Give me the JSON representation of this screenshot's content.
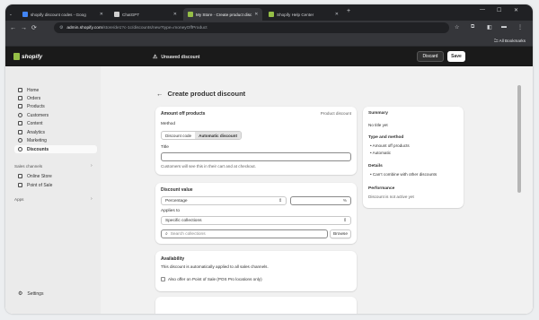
{
  "browser": {
    "tabs": [
      {
        "label": "shopify discount codes - Goog",
        "fav": "#4285f4"
      },
      {
        "label": "ChatGPT",
        "fav": "#cfcfcf"
      },
      {
        "label": "My Store · Create product disc",
        "fav": "#95bf47"
      },
      {
        "label": "Shopify Help Center",
        "fav": "#95bf47"
      }
    ],
    "url_host": "admin.shopify.com",
    "url_path": "/store/de1?c-1c/discounts/new?type=moneyOffProduct",
    "all_bookmarks": "All Bookmarks"
  },
  "topbar": {
    "logo": "shopify",
    "unsaved": "Unsaved discount",
    "discard": "Discard",
    "save": "Save"
  },
  "sidebar": {
    "items": [
      {
        "label": "Home",
        "icon": "home-icon"
      },
      {
        "label": "Orders",
        "icon": "orders-icon"
      },
      {
        "label": "Products",
        "icon": "tag-icon"
      },
      {
        "label": "Customers",
        "icon": "person-icon"
      },
      {
        "label": "Content",
        "icon": "content-icon"
      },
      {
        "label": "Analytics",
        "icon": "chart-icon"
      },
      {
        "label": "Marketing",
        "icon": "target-icon"
      },
      {
        "label": "Discounts",
        "icon": "discount-icon"
      }
    ],
    "sales_channels": "Sales channels",
    "channels": [
      {
        "label": "Online Store"
      },
      {
        "label": "Point of Sale"
      }
    ],
    "apps": "Apps",
    "settings": "Settings"
  },
  "main": {
    "title": "Create product discount",
    "amount_card": {
      "title": "Amount off products",
      "tag": "Product discount",
      "method_label": "Method",
      "method_options": [
        "Discount code",
        "Automatic discount"
      ],
      "title_label": "Title",
      "title_value": "",
      "title_help": "Customers will see this in their cart and at checkout."
    },
    "value_card": {
      "title": "Discount value",
      "value_type": "Percentage",
      "value_amount": "",
      "percent_suffix": "%",
      "applies_label": "Applies to",
      "applies_value": "Specific collections",
      "search_placeholder": "Search collections",
      "browse": "Browse"
    },
    "availability_card": {
      "title": "Availability",
      "desc": "This discount is automatically applied to all sales channels.",
      "checkbox": "Also offer on Point of Sale (POS Pro locations only)"
    },
    "summary": {
      "title": "Summary",
      "no_title": "No title yet",
      "type_heading": "Type and method",
      "type_items": [
        "Amount off products",
        "Automatic"
      ],
      "details_heading": "Details",
      "details_items": [
        "Can’t combine with other discounts"
      ],
      "perf_heading": "Performance",
      "perf_text": "Discount is not active yet"
    }
  }
}
